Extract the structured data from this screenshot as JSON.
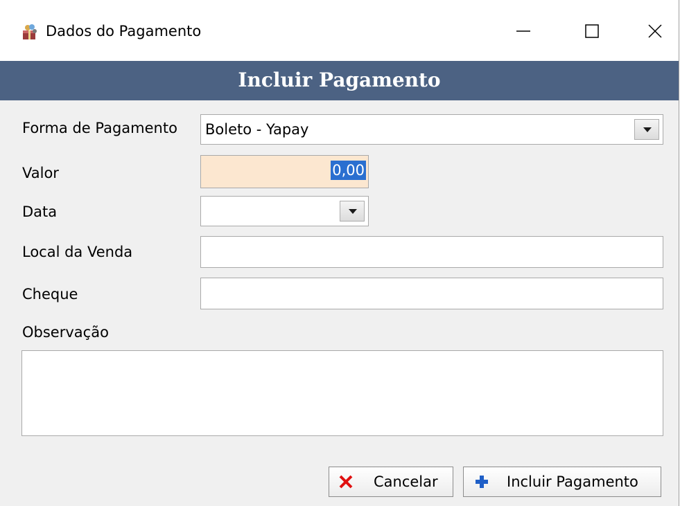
{
  "window": {
    "title": "Dados do Pagamento",
    "icon": "wrapped-gift-app-icon"
  },
  "window_controls": [
    "minimize",
    "maximize",
    "close"
  ],
  "header": {
    "title": "Incluir Pagamento",
    "background": "#4c6283"
  },
  "form": {
    "forma_label": "Forma de Pagamento",
    "forma_value": "Boleto - Yapay",
    "valor_label": "Valor",
    "valor_value": "0,00",
    "data_label": "Data",
    "data_value": "",
    "local_label": "Local da Venda",
    "local_value": "",
    "cheque_label": "Cheque",
    "cheque_value": "",
    "obs_label": "Observação",
    "obs_value": ""
  },
  "buttons": {
    "cancel_label": "Cancelar",
    "include_label": "Incluir Pagamento"
  },
  "colors": {
    "valor_bg": "#fce7d0",
    "selection": "#2a6fd0",
    "cancel_icon": "#e01010",
    "include_icon": "#1f5fc7"
  }
}
